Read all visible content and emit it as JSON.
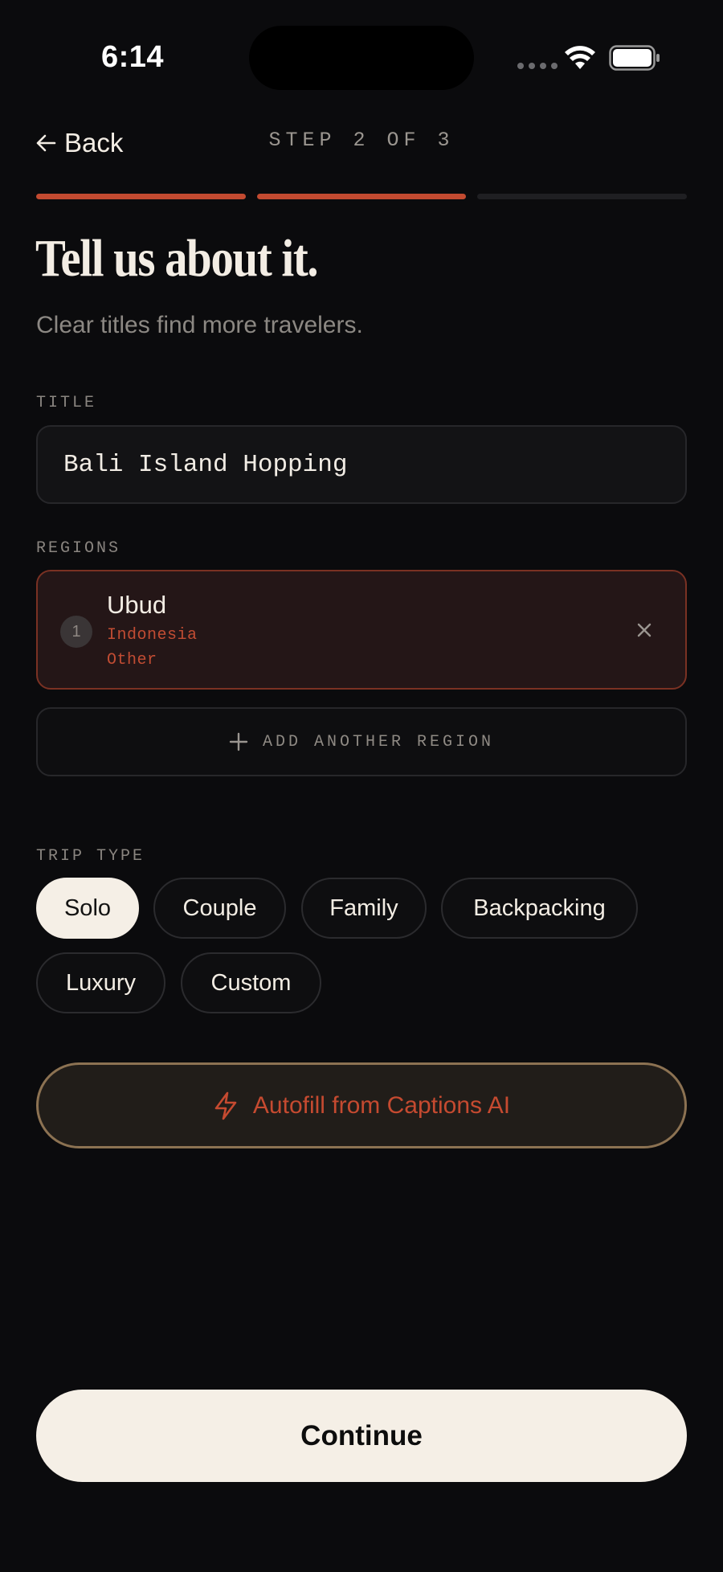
{
  "status_bar": {
    "time": "6:14"
  },
  "nav": {
    "back_label": "Back",
    "step_label": "STEP 2 OF 3",
    "progress": {
      "current_step": 2,
      "total_steps": 3
    }
  },
  "header": {
    "title": "Tell us about it.",
    "subtitle": "Clear titles find more travelers."
  },
  "title_field": {
    "label": "TITLE",
    "value": "Bali Island Hopping"
  },
  "regions": {
    "label": "REGIONS",
    "items": [
      {
        "number": "1",
        "name": "Ubud",
        "country": "Indonesia",
        "area": "Other"
      }
    ],
    "add_label": "ADD ANOTHER REGION"
  },
  "trip_type": {
    "label": "TRIP TYPE",
    "options": [
      "Solo",
      "Couple",
      "Family",
      "Backpacking",
      "Luxury",
      "Custom"
    ],
    "selected": "Solo"
  },
  "autofill": {
    "label": "Autofill from Captions AI"
  },
  "continue": {
    "label": "Continue"
  },
  "colors": {
    "background": "#0b0b0d",
    "accent": "#c24a30",
    "cream": "#f5efe6",
    "autofill_border": "#8c7252"
  }
}
